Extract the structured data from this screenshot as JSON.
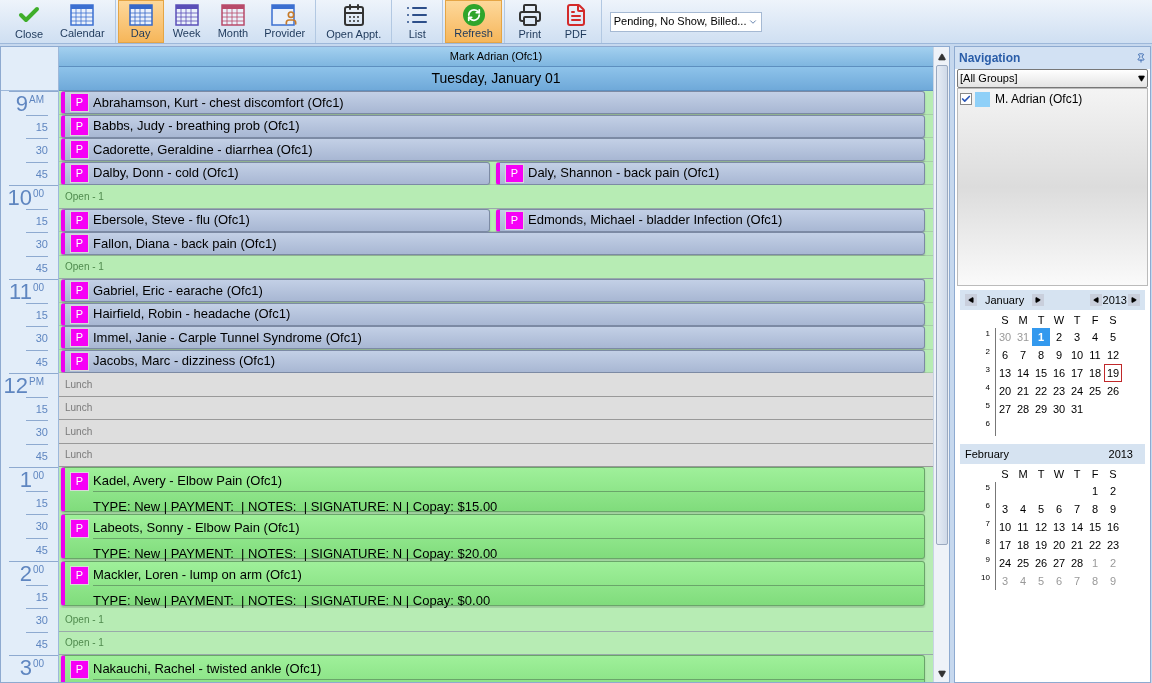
{
  "toolbar": {
    "groups": [
      {
        "buttons": [
          {
            "kind": "close",
            "label": "Close",
            "selected": false
          },
          {
            "kind": "calendar",
            "label": "Calendar",
            "selected": false
          }
        ]
      },
      {
        "buttons": [
          {
            "kind": "day",
            "label": "Day",
            "selected": true
          },
          {
            "kind": "week",
            "label": "Week",
            "selected": false
          },
          {
            "kind": "month",
            "label": "Month",
            "selected": false
          },
          {
            "kind": "provider",
            "label": "Provider",
            "selected": false
          }
        ]
      },
      {
        "buttons": [
          {
            "kind": "open",
            "label": "Open Appt.",
            "selected": false
          }
        ]
      },
      {
        "buttons": [
          {
            "kind": "list",
            "label": "List",
            "selected": false
          }
        ]
      },
      {
        "buttons": [
          {
            "kind": "refresh",
            "label": "Refresh",
            "selected": true
          }
        ]
      },
      {
        "buttons": [
          {
            "kind": "print",
            "label": "Print",
            "selected": false
          },
          {
            "kind": "pdf",
            "label": "PDF",
            "selected": false
          }
        ]
      }
    ],
    "filter": {
      "value": "Pending, No Show, Billed..."
    }
  },
  "schedule": {
    "provider": "Mark Adrian (Ofc1)",
    "date": "Tuesday, January 01",
    "time_rows": [
      {
        "hour": "9",
        "suffix": "AM"
      },
      {
        "minute": "15"
      },
      {
        "minute": "30"
      },
      {
        "minute": "45"
      },
      {
        "hour": "10",
        "suffix": "00"
      },
      {
        "minute": "15"
      },
      {
        "minute": "30"
      },
      {
        "minute": "45"
      },
      {
        "hour": "11",
        "suffix": "00"
      },
      {
        "minute": "15"
      },
      {
        "minute": "30"
      },
      {
        "minute": "45"
      },
      {
        "hour": "12",
        "suffix": "PM"
      },
      {
        "minute": "15"
      },
      {
        "minute": "30"
      },
      {
        "minute": "45"
      },
      {
        "hour": "1",
        "suffix": "00"
      },
      {
        "minute": "15"
      },
      {
        "minute": "30"
      },
      {
        "minute": "45"
      },
      {
        "hour": "2",
        "suffix": "00"
      },
      {
        "minute": "15"
      },
      {
        "minute": "30"
      },
      {
        "minute": "45"
      },
      {
        "hour": "3",
        "suffix": "00"
      }
    ],
    "blocks": [
      {
        "kind": "booked",
        "appointments": [
          {
            "status": "P",
            "text": "Abrahamson, Kurt - chest discomfort (Ofc1)"
          }
        ]
      },
      {
        "kind": "booked",
        "appointments": [
          {
            "status": "P",
            "text": "Babbs, Judy - breathing prob (Ofc1)"
          }
        ]
      },
      {
        "kind": "booked",
        "appointments": [
          {
            "status": "P",
            "text": "Cadorette, Geraldine - diarrhea (Ofc1)"
          }
        ]
      },
      {
        "kind": "booked",
        "appointments": [
          {
            "status": "P",
            "text": "Dalby, Donn - cold (Ofc1)"
          },
          {
            "status": "P",
            "text": "Daly, Shannon - back pain (Ofc1)"
          }
        ]
      },
      {
        "kind": "open",
        "label": "Open - 1"
      },
      {
        "kind": "booked",
        "appointments": [
          {
            "status": "P",
            "text": "Ebersole, Steve - flu (Ofc1)"
          },
          {
            "status": "P",
            "text": "Edmonds, Michael - bladder Infection (Ofc1)"
          }
        ]
      },
      {
        "kind": "booked",
        "appointments": [
          {
            "status": "P",
            "text": "Fallon, Diana - back pain (Ofc1)"
          }
        ]
      },
      {
        "kind": "open",
        "label": "Open - 1"
      },
      {
        "kind": "booked",
        "appointments": [
          {
            "status": "P",
            "text": "Gabriel, Eric - earache (Ofc1)"
          }
        ]
      },
      {
        "kind": "booked",
        "appointments": [
          {
            "status": "P",
            "text": "Hairfield, Robin - headache (Ofc1)"
          }
        ]
      },
      {
        "kind": "booked",
        "appointments": [
          {
            "status": "P",
            "text": "Immel, Janie - Carple Tunnel Syndrome (Ofc1)"
          }
        ]
      },
      {
        "kind": "booked",
        "appointments": [
          {
            "status": "P",
            "text": "Jacobs, Marc - dizziness (Ofc1)"
          }
        ]
      },
      {
        "kind": "lunch",
        "label": "Lunch"
      },
      {
        "kind": "lunch",
        "label": "Lunch"
      },
      {
        "kind": "lunch",
        "label": "Lunch"
      },
      {
        "kind": "lunch",
        "label": "Lunch"
      },
      {
        "kind": "detailed",
        "status": "P",
        "text": "Kadel, Avery - Elbow Pain (Ofc1)",
        "details": "TYPE: New | PAYMENT:  | NOTES:  | SIGNATURE: N | Copay: $15.00"
      },
      {
        "kind": "detailed",
        "status": "P",
        "text": "Labeots, Sonny - Elbow Pain (Ofc1)",
        "details": "TYPE: New | PAYMENT:  | NOTES:  | SIGNATURE: N | Copay: $20.00"
      },
      {
        "kind": "detailed",
        "status": "P",
        "text": "Mackler, Loren - lump on arm (Ofc1)",
        "details": "TYPE: New | PAYMENT:  | NOTES:  | SIGNATURE: N | Copay: $0.00"
      },
      {
        "kind": "open",
        "label": "Open - 1"
      },
      {
        "kind": "open",
        "label": "Open - 1"
      },
      {
        "kind": "detailed",
        "status": "P",
        "text": "Nakauchi, Rachel - twisted ankle (Ofc1)"
      }
    ]
  },
  "navigation": {
    "title": "Navigation",
    "group": "[All Groups]",
    "resources": [
      {
        "label": "M. Adrian (Ofc1)",
        "checked": true,
        "color": "#8fd0f8"
      }
    ],
    "months": [
      {
        "month": "January",
        "year": "2013",
        "arrows": true,
        "weekdays": [
          "S",
          "M",
          "T",
          "W",
          "T",
          "F",
          "S"
        ],
        "weeks": [
          {
            "week": "1",
            "days": [
              {
                "kind": "day",
                "text": "30",
                "muted": true,
                "selected": false,
                "today": false
              },
              {
                "kind": "day",
                "text": "31",
                "muted": true,
                "selected": false,
                "today": false
              },
              {
                "kind": "day",
                "text": "1",
                "muted": false,
                "selected": true,
                "today": false
              },
              {
                "kind": "day",
                "text": "2",
                "muted": false,
                "selected": false,
                "today": false
              },
              {
                "kind": "day",
                "text": "3",
                "muted": false,
                "selected": false,
                "today": false
              },
              {
                "kind": "day",
                "text": "4",
                "muted": false,
                "selected": false,
                "today": false
              },
              {
                "kind": "day",
                "text": "5",
                "muted": false,
                "selected": false,
                "today": false
              }
            ]
          },
          {
            "week": "2",
            "days": [
              {
                "kind": "day",
                "text": "6",
                "muted": false,
                "selected": false,
                "today": false
              },
              {
                "kind": "day",
                "text": "7",
                "muted": false,
                "selected": false,
                "today": false
              },
              {
                "kind": "day",
                "text": "8",
                "muted": false,
                "selected": false,
                "today": false
              },
              {
                "kind": "day",
                "text": "9",
                "muted": false,
                "selected": false,
                "today": false
              },
              {
                "kind": "day",
                "text": "10",
                "muted": false,
                "selected": false,
                "today": false
              },
              {
                "kind": "day",
                "text": "11",
                "muted": false,
                "selected": false,
                "today": false
              },
              {
                "kind": "day",
                "text": "12",
                "muted": false,
                "selected": false,
                "today": false
              }
            ]
          },
          {
            "week": "3",
            "days": [
              {
                "kind": "day",
                "text": "13",
                "muted": false,
                "selected": false,
                "today": false
              },
              {
                "kind": "day",
                "text": "14",
                "muted": false,
                "selected": false,
                "today": false
              },
              {
                "kind": "day",
                "text": "15",
                "muted": false,
                "selected": false,
                "today": false
              },
              {
                "kind": "day",
                "text": "16",
                "muted": false,
                "selected": false,
                "today": false
              },
              {
                "kind": "day",
                "text": "17",
                "muted": false,
                "selected": false,
                "today": false
              },
              {
                "kind": "day",
                "text": "18",
                "muted": false,
                "selected": false,
                "today": false
              },
              {
                "kind": "day",
                "text": "19",
                "muted": false,
                "selected": false,
                "today": true
              }
            ]
          },
          {
            "week": "4",
            "days": [
              {
                "kind": "day",
                "text": "20",
                "muted": false,
                "selected": false,
                "today": false
              },
              {
                "kind": "day",
                "text": "21",
                "muted": false,
                "selected": false,
                "today": false
              },
              {
                "kind": "day",
                "text": "22",
                "muted": false,
                "selected": false,
                "today": false
              },
              {
                "kind": "day",
                "text": "23",
                "muted": false,
                "selected": false,
                "today": false
              },
              {
                "kind": "day",
                "text": "24",
                "muted": false,
                "selected": false,
                "today": false
              },
              {
                "kind": "day",
                "text": "25",
                "muted": false,
                "selected": false,
                "today": false
              },
              {
                "kind": "day",
                "text": "26",
                "muted": false,
                "selected": false,
                "today": false
              }
            ]
          },
          {
            "week": "5",
            "days": [
              {
                "kind": "day",
                "text": "27",
                "muted": false,
                "selected": false,
                "today": false
              },
              {
                "kind": "day",
                "text": "28",
                "muted": false,
                "selected": false,
                "today": false
              },
              {
                "kind": "day",
                "text": "29",
                "muted": false,
                "selected": false,
                "today": false
              },
              {
                "kind": "day",
                "text": "30",
                "muted": false,
                "selected": false,
                "today": false
              },
              {
                "kind": "day",
                "text": "31",
                "muted": false,
                "selected": false,
                "today": false
              }
            ]
          },
          {
            "week": "6"
          }
        ]
      },
      {
        "month": "February",
        "year": "2013",
        "arrows": false,
        "weekdays": [
          "S",
          "M",
          "T",
          "W",
          "T",
          "F",
          "S"
        ],
        "weeks": [
          {
            "week": "5",
            "days": [
              {
                "kind": "blank"
              },
              {
                "kind": "blank"
              },
              {
                "kind": "blank"
              },
              {
                "kind": "blank"
              },
              {
                "kind": "blank"
              },
              {
                "kind": "day",
                "text": "1",
                "muted": false,
                "selected": false,
                "today": false
              },
              {
                "kind": "day",
                "text": "2",
                "muted": false,
                "selected": false,
                "today": false
              }
            ]
          },
          {
            "week": "6",
            "days": [
              {
                "kind": "day",
                "text": "3",
                "muted": false,
                "selected": false,
                "today": false
              },
              {
                "kind": "day",
                "text": "4",
                "muted": false,
                "selected": false,
                "today": false
              },
              {
                "kind": "day",
                "text": "5",
                "muted": false,
                "selected": false,
                "today": false
              },
              {
                "kind": "day",
                "text": "6",
                "muted": false,
                "selected": false,
                "today": false
              },
              {
                "kind": "day",
                "text": "7",
                "muted": false,
                "selected": false,
                "today": false
              },
              {
                "kind": "day",
                "text": "8",
                "muted": false,
                "selected": false,
                "today": false
              },
              {
                "kind": "day",
                "text": "9",
                "muted": false,
                "selected": false,
                "today": false
              }
            ]
          },
          {
            "week": "7",
            "days": [
              {
                "kind": "day",
                "text": "10",
                "muted": false,
                "selected": false,
                "today": false
              },
              {
                "kind": "day",
                "text": "11",
                "muted": false,
                "selected": false,
                "today": false
              },
              {
                "kind": "day",
                "text": "12",
                "muted": false,
                "selected": false,
                "today": false
              },
              {
                "kind": "day",
                "text": "13",
                "muted": false,
                "selected": false,
                "today": false
              },
              {
                "kind": "day",
                "text": "14",
                "muted": false,
                "selected": false,
                "today": false
              },
              {
                "kind": "day",
                "text": "15",
                "muted": false,
                "selected": false,
                "today": false
              },
              {
                "kind": "day",
                "text": "16",
                "muted": false,
                "selected": false,
                "today": false
              }
            ]
          },
          {
            "week": "8",
            "days": [
              {
                "kind": "day",
                "text": "17",
                "muted": false,
                "selected": false,
                "today": false
              },
              {
                "kind": "day",
                "text": "18",
                "muted": false,
                "selected": false,
                "today": false
              },
              {
                "kind": "day",
                "text": "19",
                "muted": false,
                "selected": false,
                "today": false
              },
              {
                "kind": "day",
                "text": "20",
                "muted": false,
                "selected": false,
                "today": false
              },
              {
                "kind": "day",
                "text": "21",
                "muted": false,
                "selected": false,
                "today": false
              },
              {
                "kind": "day",
                "text": "22",
                "muted": false,
                "selected": false,
                "today": false
              },
              {
                "kind": "day",
                "text": "23",
                "muted": false,
                "selected": false,
                "today": false
              }
            ]
          },
          {
            "week": "9",
            "days": [
              {
                "kind": "day",
                "text": "24",
                "muted": false,
                "selected": false,
                "today": false
              },
              {
                "kind": "day",
                "text": "25",
                "muted": false,
                "selected": false,
                "today": false
              },
              {
                "kind": "day",
                "text": "26",
                "muted": false,
                "selected": false,
                "today": false
              },
              {
                "kind": "day",
                "text": "27",
                "muted": false,
                "selected": false,
                "today": false
              },
              {
                "kind": "day",
                "text": "28",
                "muted": false,
                "selected": false,
                "today": false
              },
              {
                "kind": "day",
                "text": "1",
                "muted": true,
                "selected": false,
                "today": false
              },
              {
                "kind": "day",
                "text": "2",
                "muted": true,
                "selected": false,
                "today": false
              }
            ]
          },
          {
            "week": "10",
            "days": [
              {
                "kind": "day",
                "text": "3",
                "muted": true,
                "selected": false,
                "today": false
              },
              {
                "kind": "day",
                "text": "4",
                "muted": true,
                "selected": false,
                "today": false
              },
              {
                "kind": "day",
                "text": "5",
                "muted": true,
                "selected": false,
                "today": false
              },
              {
                "kind": "day",
                "text": "6",
                "muted": true,
                "selected": false,
                "today": false
              },
              {
                "kind": "day",
                "text": "7",
                "muted": true,
                "selected": false,
                "today": false
              },
              {
                "kind": "day",
                "text": "8",
                "muted": true,
                "selected": false,
                "today": false
              },
              {
                "kind": "day",
                "text": "9",
                "muted": true,
                "selected": false,
                "today": false
              }
            ]
          }
        ]
      }
    ]
  }
}
